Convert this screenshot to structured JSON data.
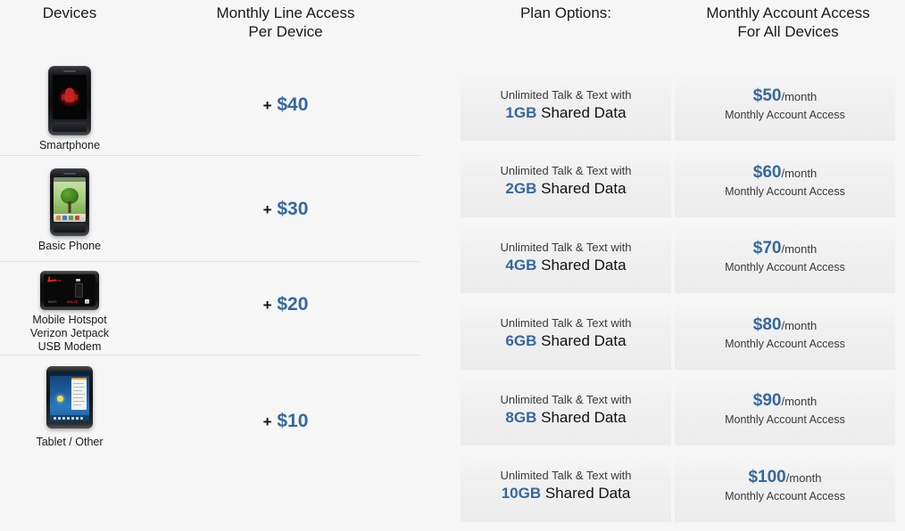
{
  "headers": {
    "devices": "Devices",
    "line_access_l1": "Monthly Line Access",
    "line_access_l2": "Per Device",
    "plan_options": "Plan Options:",
    "account_access_l1": "Monthly Account Access",
    "account_access_l2": "For All Devices"
  },
  "devices": [
    {
      "label": "Smartphone",
      "label_lines": [
        "Smartphone"
      ],
      "icon": "smartphone-icon",
      "price_plus": "+",
      "price": "$40"
    },
    {
      "label": "Basic Phone",
      "label_lines": [
        "Basic Phone"
      ],
      "icon": "basic-phone-icon",
      "price_plus": "+",
      "price": "$30"
    },
    {
      "label": "Mobile Hotspot Verizon Jetpack USB Modem",
      "label_lines": [
        "Mobile Hotspot",
        "Verizon Jetpack",
        "USB Modem"
      ],
      "icon": "mobile-hotspot-icon",
      "price_plus": "+",
      "price": "$20"
    },
    {
      "label": "Tablet / Other",
      "label_lines": [
        "Tablet / Other"
      ],
      "icon": "tablet-icon",
      "price_plus": "+",
      "price": "$10"
    }
  ],
  "plans": [
    {
      "option_line1": "Unlimited Talk & Text with",
      "data_amount": "1GB",
      "option_line2_rest": "Shared Data",
      "price": "$50",
      "per": "/month",
      "sub": "Monthly Account Access"
    },
    {
      "option_line1": "Unlimited Talk & Text with",
      "data_amount": "2GB",
      "option_line2_rest": "Shared Data",
      "price": "$60",
      "per": "/month",
      "sub": "Monthly Account Access"
    },
    {
      "option_line1": "Unlimited Talk & Text with",
      "data_amount": "4GB",
      "option_line2_rest": "Shared Data",
      "price": "$70",
      "per": "/month",
      "sub": "Monthly Account Access"
    },
    {
      "option_line1": "Unlimited Talk & Text with",
      "data_amount": "6GB",
      "option_line2_rest": "Shared Data",
      "price": "$80",
      "per": "/month",
      "sub": "Monthly Account Access"
    },
    {
      "option_line1": "Unlimited Talk & Text with",
      "data_amount": "8GB",
      "option_line2_rest": "Shared Data",
      "price": "$90",
      "per": "/month",
      "sub": "Monthly Account Access"
    },
    {
      "option_line1": "Unlimited Talk & Text with",
      "data_amount": "10GB",
      "option_line2_rest": "Shared Data",
      "price": "$100",
      "per": "/month",
      "sub": "Monthly Account Access"
    }
  ],
  "colors": {
    "accent_blue": "#36679f",
    "page_background": "#f6f6f6",
    "card_background": "#f1f1f1",
    "divider": "#e4e4e4",
    "text": "#111111"
  }
}
